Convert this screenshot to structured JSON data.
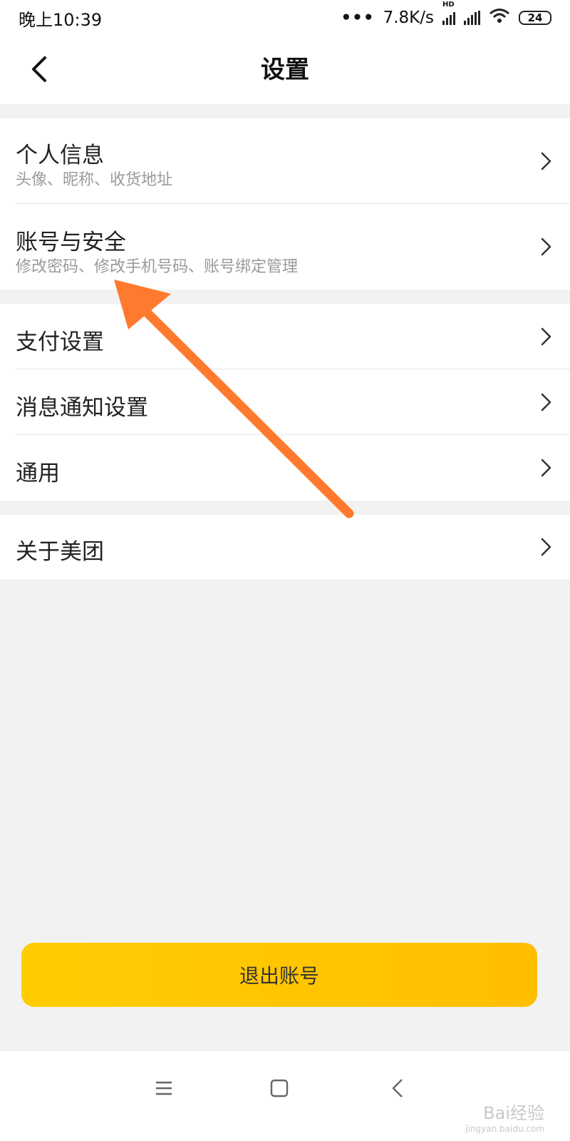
{
  "status_bar": {
    "time": "晚上10:39",
    "network_speed": "7.8K/s",
    "hd_label": "HD",
    "battery": "24",
    "icons": [
      "dots-icon",
      "signal-icon",
      "wifi-icon",
      "battery-icon"
    ]
  },
  "nav": {
    "title": "设置",
    "back_icon": "chevron-left-icon"
  },
  "groups": [
    {
      "items": [
        {
          "title": "个人信息",
          "subtitle": "头像、昵称、收货地址"
        },
        {
          "title": "账号与安全",
          "subtitle": "修改密码、修改手机号码、账号绑定管理"
        }
      ]
    },
    {
      "items": [
        {
          "title": "支付设置"
        },
        {
          "title": "消息通知设置"
        },
        {
          "title": "通用"
        }
      ]
    },
    {
      "items": [
        {
          "title": "关于美团"
        }
      ]
    }
  ],
  "logout_button": "退出账号",
  "system_nav": {
    "icons": [
      "menu-icon",
      "home-square-icon",
      "back-icon"
    ]
  },
  "watermark": {
    "text": "Bai经验",
    "url": "jingyan.baidu.com"
  },
  "colors": {
    "accent_yellow": "#ffc700",
    "annotation_arrow": "#ff7a2e",
    "page_bg": "#f2f2f2"
  }
}
